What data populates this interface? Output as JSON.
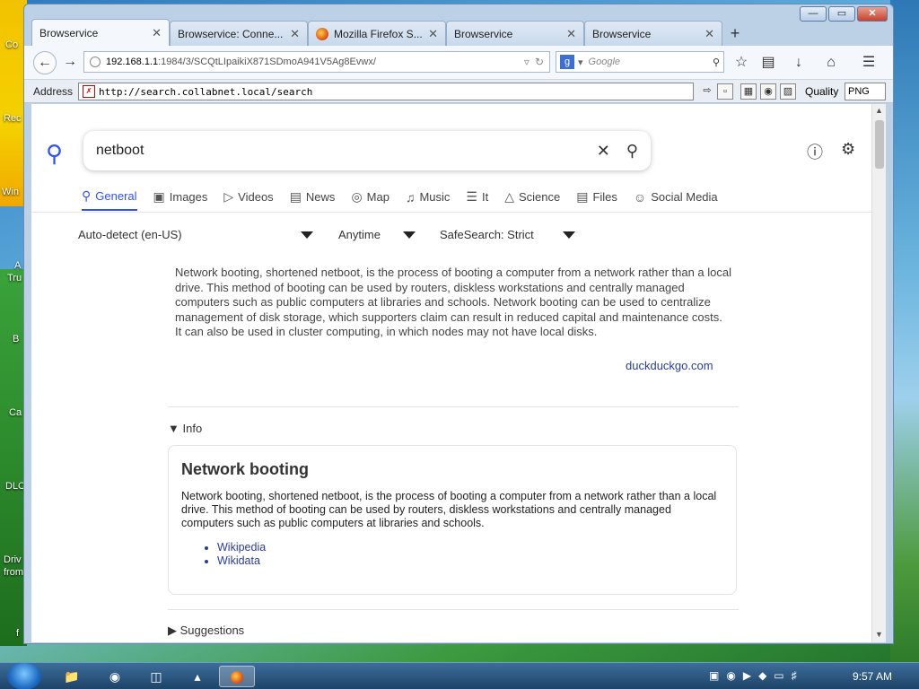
{
  "desktop": {
    "icon_labels": [
      "Co",
      "Rec",
      "Win",
      "A",
      "Tru",
      "B",
      "Ca",
      "DLC",
      "Driv",
      "from",
      "f"
    ]
  },
  "window": {
    "controls": {
      "minimize": "—",
      "maximize": "▭",
      "close": "✕"
    }
  },
  "tabs": [
    {
      "label": "Browservice",
      "icon": "page-icon"
    },
    {
      "label": "Browservice: Conne...",
      "icon": "page-icon"
    },
    {
      "label": "Mozilla Firefox S...",
      "icon": "firefox-icon"
    },
    {
      "label": "Browservice",
      "icon": "page-icon"
    },
    {
      "label": "Browservice",
      "icon": "page-icon"
    }
  ],
  "tab_close": "✕",
  "new_tab": "+",
  "nav": {
    "url_host": "192.168.1.1",
    "url_path": ":1984/3/SCQtLIpaikiX871SDmoA941V5Ag8Evwx/",
    "search_placeholder": "Google",
    "search_engine_letter": "g"
  },
  "addressbar": {
    "label": "Address",
    "url": "http://search.collabnet.local/search",
    "quality_label": "Quality",
    "quality_value": "PNG"
  },
  "page": {
    "query": "netboot",
    "categories": [
      {
        "label": "General",
        "icon": "search-icon",
        "active": true
      },
      {
        "label": "Images",
        "icon": "image-icon"
      },
      {
        "label": "Videos",
        "icon": "play-icon"
      },
      {
        "label": "News",
        "icon": "newspaper-icon"
      },
      {
        "label": "Map",
        "icon": "map-pin-icon"
      },
      {
        "label": "Music",
        "icon": "music-icon"
      },
      {
        "label": "It",
        "icon": "layers-icon"
      },
      {
        "label": "Science",
        "icon": "school-icon"
      },
      {
        "label": "Files",
        "icon": "files-icon"
      },
      {
        "label": "Social Media",
        "icon": "people-icon"
      }
    ],
    "filters": {
      "language": "Auto-detect (en-US)",
      "time": "Anytime",
      "safesearch": "SafeSearch: Strict"
    },
    "abstract": "Network booting, shortened netboot, is the process of booting a computer from a network rather than a local drive. This method of booting can be used by routers, diskless workstations and centrally managed computers such as public computers at libraries and schools. Network booting can be used to centralize management of disk storage, which supporters claim can result in reduced capital and maintenance costs. It can also be used in cluster computing, in which nodes may not have local disks.",
    "abstract_source": "duckduckgo.com",
    "info_toggle": "Info",
    "info_title": "Network booting",
    "info_text": "Network booting, shortened netboot, is the process of booting a computer from a network rather than a local drive. This method of booting can be used by routers, diskless workstations and centrally managed computers such as public computers at libraries and schools.",
    "info_links": [
      "Wikipedia",
      "Wikidata"
    ],
    "suggestions_toggle": "Suggestions"
  },
  "taskbar": {
    "clock": "9:57 AM"
  },
  "colors": {
    "accent": "#3050ff",
    "link": "#2a3c9e"
  }
}
